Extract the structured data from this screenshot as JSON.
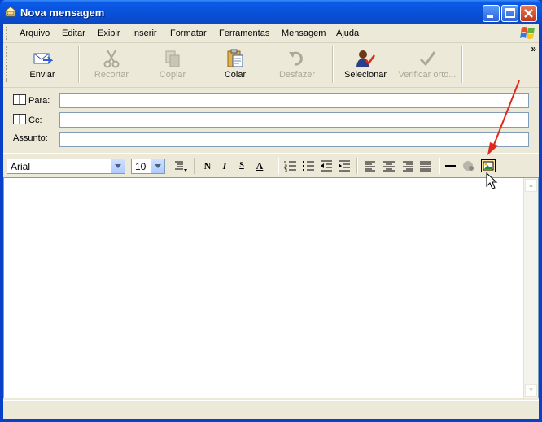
{
  "window": {
    "title": "Nova mensagem"
  },
  "menu": [
    "Arquivo",
    "Editar",
    "Exibir",
    "Inserir",
    "Formatar",
    "Ferramentas",
    "Mensagem",
    "Ajuda"
  ],
  "toolbar": {
    "send": "Enviar",
    "cut": "Recortar",
    "copy": "Copiar",
    "paste": "Colar",
    "undo": "Desfazer",
    "select": "Selecionar",
    "spell": "Verificar orto...",
    "more": "»"
  },
  "header": {
    "to_label": "Para:",
    "cc_label": "Cc:",
    "subject_label": "Assunto:",
    "to_value": "",
    "cc_value": "",
    "subject_value": ""
  },
  "format": {
    "font": "Arial",
    "size": "10",
    "bold": "N",
    "italic": "I",
    "underline": "S",
    "font_color": "A"
  },
  "colors": {
    "title_bar": "#0a4fd8",
    "chrome": "#ece9d8",
    "annotation_arrow": "#e0281b"
  }
}
